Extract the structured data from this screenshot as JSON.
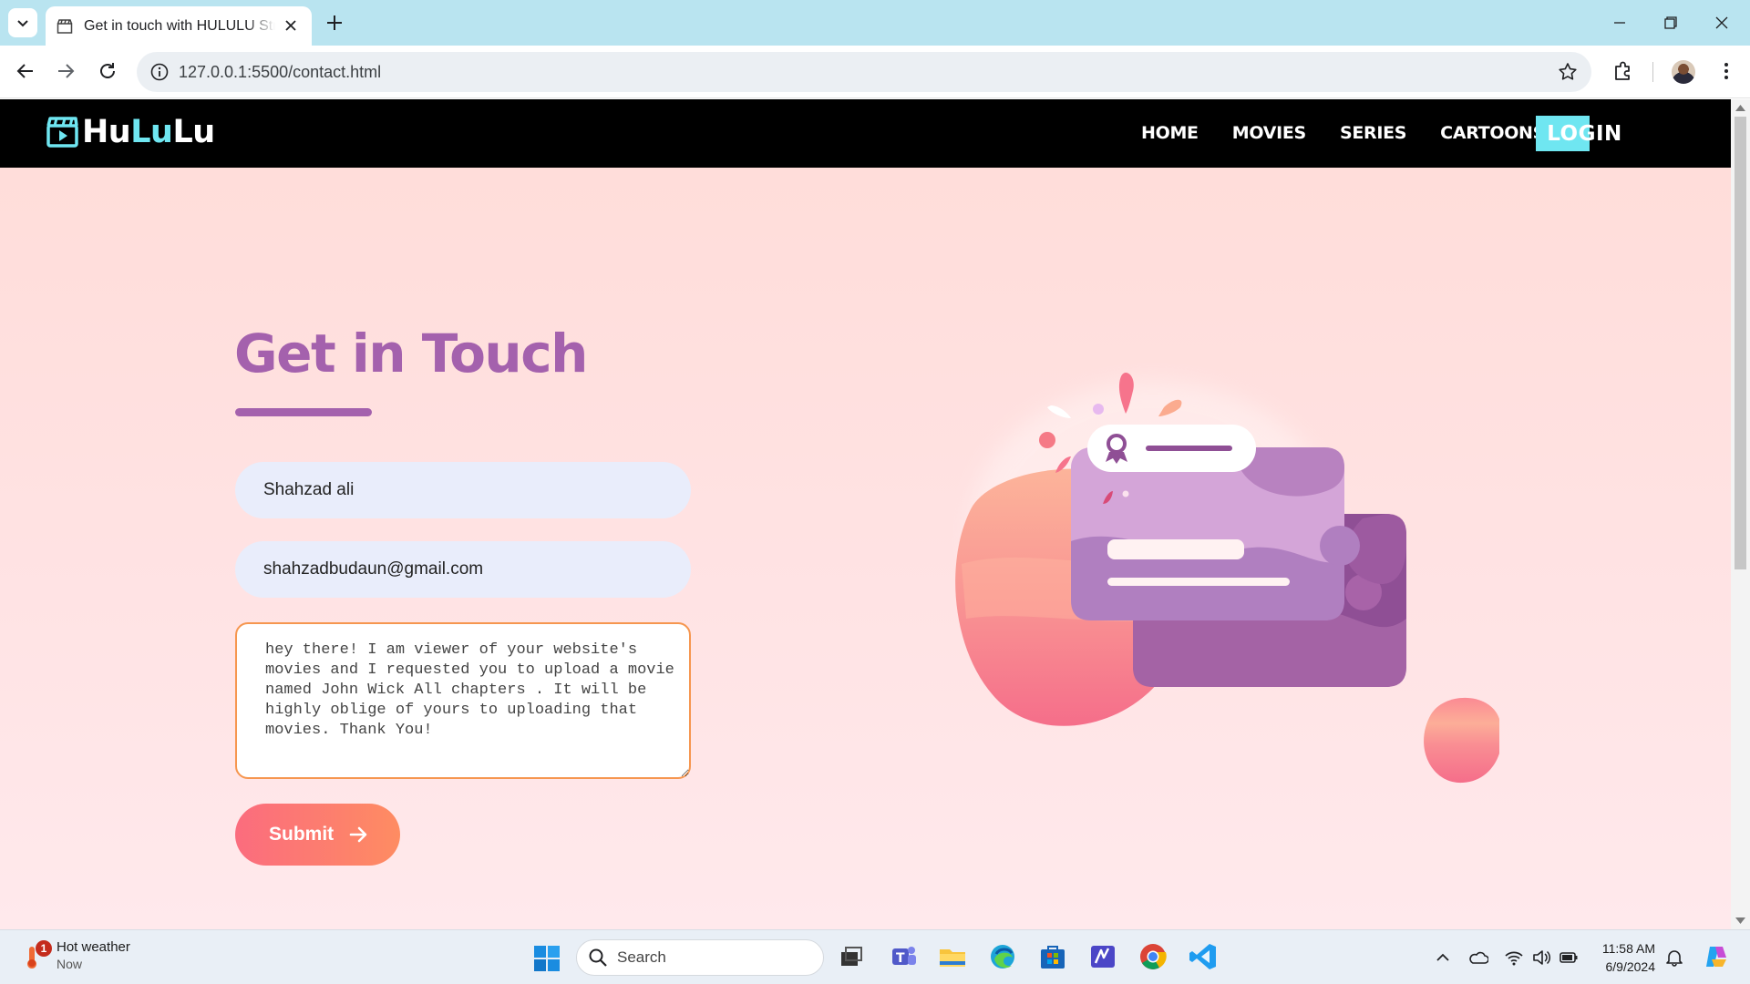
{
  "browser": {
    "tab_title": "Get in touch with HULULU Streaming",
    "url": "127.0.0.1:5500/contact.html"
  },
  "site": {
    "logo_part1": "Hu",
    "logo_part2": "Lu",
    "logo_part3": "Lu",
    "nav": [
      "HOME",
      "MOVIES",
      "SERIES",
      "CARTOONS"
    ],
    "login_label": "LOGIN"
  },
  "contact": {
    "heading": "Get in Touch",
    "name_value": "Shahzad ali",
    "email_value": "shahzadbudaun@gmail.com",
    "message_value": "hey there! I am viewer of your website's movies and I requested you to upload a movie named John Wick All chapters . It will be highly oblige of yours to uploading that movies. Thank You!",
    "submit_label": "Submit"
  },
  "taskbar": {
    "weather_title": "Hot weather",
    "weather_sub": "Now",
    "weather_badge": "1",
    "search_placeholder": "Search",
    "time": "11:58 AM",
    "date": "6/9/2024"
  },
  "colors": {
    "accent_purple": "#a461ad",
    "nav_cyan": "#6fe6f1",
    "submit_start": "#fb6c7e",
    "submit_end": "#fe8c62",
    "message_border": "#f6964f"
  }
}
